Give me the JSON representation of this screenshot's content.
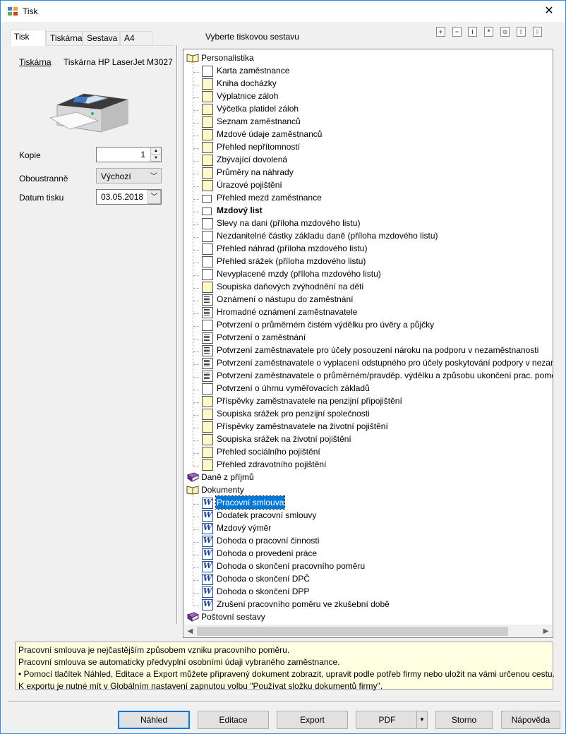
{
  "window": {
    "title": "Tisk",
    "close_glyph": "✕"
  },
  "tabs": [
    "Tisk",
    "Tiskárna",
    "Sestava",
    "A4"
  ],
  "left": {
    "printer_label": "Tiskárna",
    "printer_name": "Tiskárna HP LaserJet M3027",
    "copies_label": "Kopie",
    "copies_value": "1",
    "duplex_label": "Oboustranně",
    "duplex_value": "Výchozí",
    "date_label": "Datum tisku",
    "date_value": "03.05.2018"
  },
  "tree": {
    "caption": "Vyberte tiskovou sestavu",
    "toolbar": [
      {
        "icon": "add-icon",
        "glyph": "+"
      },
      {
        "icon": "remove-icon",
        "glyph": "−"
      },
      {
        "icon": "info-icon",
        "glyph": "i"
      },
      {
        "icon": "star-icon",
        "glyph": "*"
      },
      {
        "icon": "copy-icon",
        "glyph": "⧉"
      },
      {
        "icon": "move-up-icon",
        "glyph": "⇧"
      },
      {
        "icon": "move-down-icon",
        "glyph": "⇩"
      }
    ],
    "groups": [
      {
        "label": "Personalistika",
        "icon": "open-book-icon",
        "items": [
          {
            "label": "Karta zaměstnance",
            "icon": "white-doc-icon"
          },
          {
            "label": "Kniha docházky",
            "icon": "yellow-doc-icon"
          },
          {
            "label": "Výplatnice záloh",
            "icon": "yellow-doc-icon"
          },
          {
            "label": "Výčetka platidel záloh",
            "icon": "yellow-doc-icon"
          },
          {
            "label": "Seznam zaměstnanců",
            "icon": "yellow-doc-icon"
          },
          {
            "label": "Mzdové údaje zaměstnanců",
            "icon": "yellow-doc-icon"
          },
          {
            "label": "Přehled nepřítomností",
            "icon": "yellow-doc-icon"
          },
          {
            "label": "Zbývající dovolená",
            "icon": "yellow-doc-icon"
          },
          {
            "label": "Průměry na náhrady",
            "icon": "yellow-doc-icon"
          },
          {
            "label": "Úrazové pojištění",
            "icon": "yellow-doc-icon"
          },
          {
            "label": "Přehled mezd zaměstnance",
            "icon": "landscape-doc-icon"
          },
          {
            "label": "Mzdový list",
            "icon": "landscape-doc-icon",
            "bold": true
          },
          {
            "label": "Slevy na dani (příloha mzdového listu)",
            "icon": "white-doc-icon"
          },
          {
            "label": "Nezdanitelné částky základu daně (příloha mzdového listu)",
            "icon": "white-doc-icon"
          },
          {
            "label": "Přehled náhrad (příloha mzdového listu)",
            "icon": "white-doc-icon"
          },
          {
            "label": "Přehled srážek (příloha mzdového listu)",
            "icon": "white-doc-icon"
          },
          {
            "label": "Nevyplacené mzdy (příloha mzdového listu)",
            "icon": "white-doc-icon"
          },
          {
            "label": "Soupiska daňových zvýhodnění na děti",
            "icon": "yellow-doc-icon"
          },
          {
            "label": "Oznámení o nástupu do zaměstnání",
            "icon": "form-doc-icon"
          },
          {
            "label": "Hromadné oznámení zaměstnavatele",
            "icon": "form-doc-icon"
          },
          {
            "label": "Potvrzení o průměrném čistém výdělku pro úvěry a půjčky",
            "icon": "white-doc-icon"
          },
          {
            "label": "Potvrzení o zaměstnání",
            "icon": "form-doc-icon"
          },
          {
            "label": "Potvrzení zaměstnavatele pro účely posouzení nároku na podporu v nezaměstnanosti",
            "icon": "form-doc-icon"
          },
          {
            "label": "Potvrzení zaměstnavatele o vyplacení odstupného pro účely poskytování podpory v nezam",
            "icon": "form-doc-icon"
          },
          {
            "label": "Potvrzení zaměstnavatele o průměrném/pravděp. výdělku a způsobu ukončení prac. pomě",
            "icon": "form-doc-icon"
          },
          {
            "label": "Potvrzení o úhrnu vyměřovacích základů",
            "icon": "white-doc-icon"
          },
          {
            "label": "Příspěvky zaměstnavatele na penzijní připojištění",
            "icon": "yellow-doc-icon"
          },
          {
            "label": "Soupiska srážek pro penzijní společnosti",
            "icon": "yellow-doc-icon"
          },
          {
            "label": "Příspěvky zaměstnavatele na životní pojištění",
            "icon": "yellow-doc-icon"
          },
          {
            "label": "Soupiska srážek na životní pojištění",
            "icon": "yellow-doc-icon"
          },
          {
            "label": "Přehled sociálního pojištění",
            "icon": "yellow-doc-icon"
          },
          {
            "label": "Přehled zdravotního pojištění",
            "icon": "yellow-doc-icon"
          }
        ]
      },
      {
        "label": "Daně z příjmů",
        "icon": "closed-book-icon",
        "items": []
      },
      {
        "label": "Dokumenty",
        "icon": "open-book-icon",
        "items": [
          {
            "label": "Pracovní smlouva",
            "icon": "word-doc-icon",
            "selected": true
          },
          {
            "label": "Dodatek pracovní smlouvy",
            "icon": "word-doc-icon"
          },
          {
            "label": "Mzdový výměr",
            "icon": "word-doc-icon"
          },
          {
            "label": "Dohoda o pracovní činnosti",
            "icon": "word-doc-icon"
          },
          {
            "label": "Dohoda o provedení práce",
            "icon": "word-doc-icon"
          },
          {
            "label": "Dohoda o skončení pracovního poměru",
            "icon": "word-doc-icon"
          },
          {
            "label": "Dohoda o skončení DPČ",
            "icon": "word-doc-icon"
          },
          {
            "label": "Dohoda o skončení DPP",
            "icon": "word-doc-icon"
          },
          {
            "label": "Zrušení pracovního poměru ve zkušební době",
            "icon": "word-doc-icon"
          }
        ]
      },
      {
        "label": "Poštovní sestavy",
        "icon": "closed-book-icon",
        "items": []
      }
    ]
  },
  "info": [
    "Pracovní smlouva je nejčastějším způsobem vzniku pracovního poměru.",
    "Pracovní smlouva se automaticky předvyplní osobními údaji vybraného zaměstnance.",
    "• Pomocí tlačítek Náhled, Editace a Export můžete připravený dokument zobrazit, upravit podle potřeb firmy nebo uložit na vámi určenou cestu.",
    "K exportu je nutné mít v Globálním nastavení zapnutou volbu \"Používat složku dokumentů firmy\"."
  ],
  "buttons": {
    "preview": "Náhled",
    "edit": "Editace",
    "export": "Export",
    "pdf": "PDF",
    "cancel": "Storno",
    "help": "Nápověda"
  }
}
